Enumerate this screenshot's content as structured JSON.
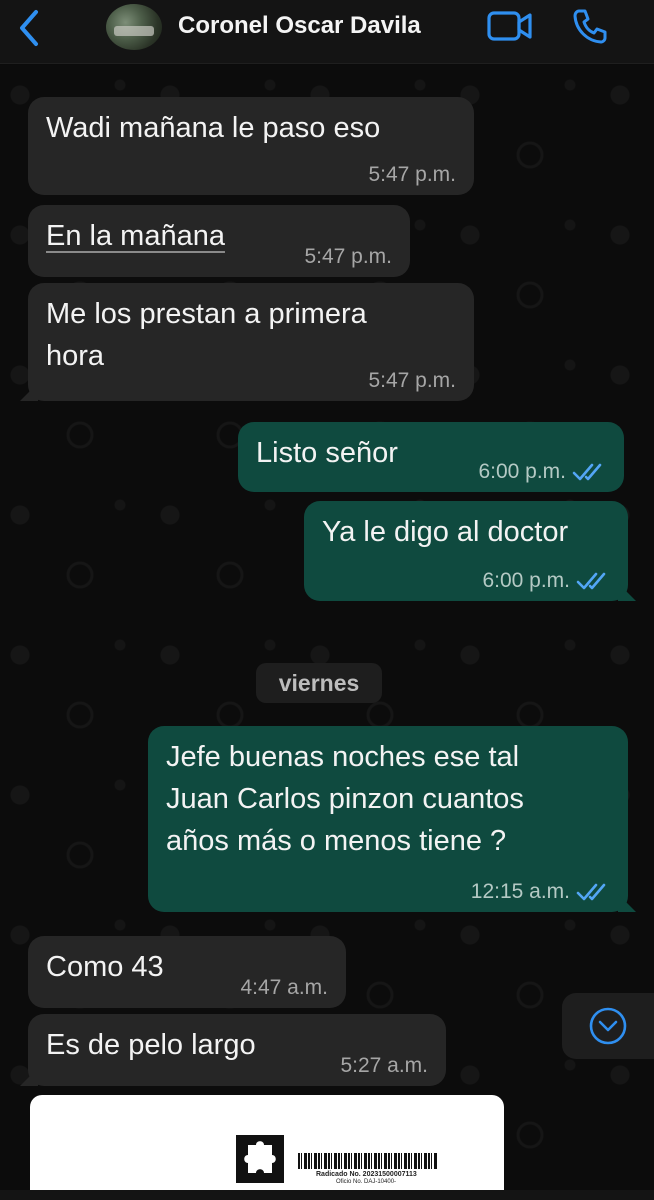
{
  "header": {
    "contact_name": "Coronel Oscar Davila",
    "icons": [
      "chevron-left-icon",
      "avatar",
      "video-call-icon",
      "phone-icon"
    ],
    "accent_color": "#2f8ff0"
  },
  "messages": [
    {
      "direction": "incoming",
      "text": "Wadi mañana le paso eso",
      "time": "5:47 p.m."
    },
    {
      "direction": "incoming",
      "text": "En la mañana",
      "time": "5:47 p.m."
    },
    {
      "direction": "incoming",
      "text": "Me los prestan a primera\nhora",
      "time": "5:47 p.m."
    },
    {
      "direction": "outgoing",
      "text": "Listo señor",
      "time": "6:00 p.m.",
      "status": "read"
    },
    {
      "direction": "outgoing",
      "text": "Ya le digo al doctor",
      "time": "6:00 p.m.",
      "status": "read"
    },
    {
      "direction": "outgoing",
      "text": "Jefe buenas noches ese tal\nJuan Carlos pinzon cuantos\naños más o menos tiene ?",
      "time": "12:15 a.m.",
      "status": "read"
    },
    {
      "direction": "incoming",
      "text": "Como 43",
      "time": "4:47 a.m."
    },
    {
      "direction": "incoming",
      "text": "Es de pelo largo",
      "time": "5:27 a.m."
    }
  ],
  "date_separator": "viernes",
  "document_preview": {
    "caption_line1": "Radicado No. 20231500007113",
    "caption_line2": "Oficio No. DAJ-10400-"
  },
  "colors": {
    "incoming_bubble": "#262626",
    "outgoing_bubble": "#0f4a3f",
    "read_ticks": "#53a6f5",
    "background": "#0c0c0c"
  }
}
